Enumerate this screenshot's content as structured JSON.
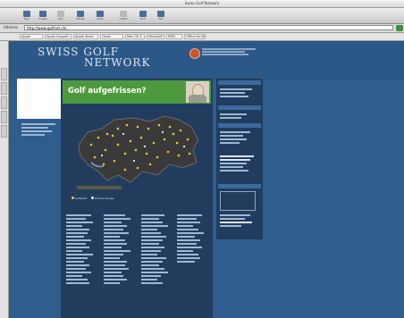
{
  "window": {
    "title": "Swiss Golf Network"
  },
  "toolbar": {
    "buttons": [
      {
        "label": "Back",
        "icon": "back-arrow-icon"
      },
      {
        "label": "Forward",
        "icon": "forward-arrow-icon"
      },
      {
        "label": "Stop",
        "icon": "stop-icon"
      },
      {
        "label": "Refresh",
        "icon": "refresh-icon"
      },
      {
        "label": "Home",
        "icon": "home-icon"
      },
      {
        "label": "AutoFill",
        "icon": "autofill-icon"
      },
      {
        "label": "Print",
        "icon": "print-icon"
      },
      {
        "label": "Mail",
        "icon": "mail-icon"
      }
    ]
  },
  "address": {
    "label": "Address",
    "value": "http://www.golfnet.ch/"
  },
  "favorites": [
    "Apple",
    "Apple Support",
    "Apple Store",
    "iTools",
    "Mac OS X",
    "Microsoft MacTopia",
    "MSN",
    "Office for Macintosh"
  ],
  "page": {
    "logo_line1": "SWISS GOLF",
    "logo_line2": "NETWORK",
    "banner": "Golf aufgefrissen?",
    "map_legend": [
      "Golfplatz",
      "Driving Range"
    ],
    "colors": {
      "page_bg": "#2f5d8e",
      "content_bg": "#223c5e",
      "banner_green": "#4d9a3e",
      "dot_yellow": "#e8c83a"
    }
  }
}
